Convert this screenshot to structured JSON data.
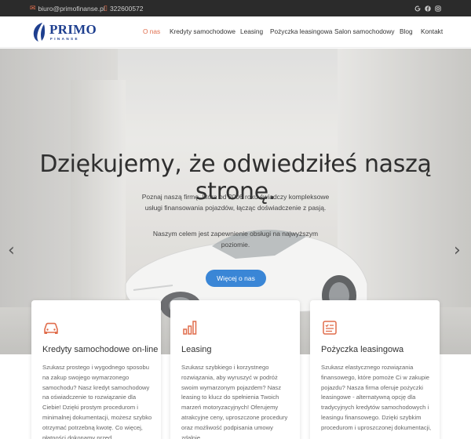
{
  "topbar": {
    "email": "biuro@primofinanse.pl",
    "phone": "322600572",
    "socials": [
      "google-icon",
      "facebook-icon",
      "instagram-icon"
    ]
  },
  "logo": {
    "name": "PRIMO",
    "sub": "FINANSE"
  },
  "nav": {
    "items": [
      {
        "label": "O nas",
        "active": true
      },
      {
        "label": "Kredyty samochodowe"
      },
      {
        "label": "Leasing"
      },
      {
        "label": "Pożyczka leasingowa"
      },
      {
        "label": "Salon samochodowy"
      },
      {
        "label": "Blog"
      },
      {
        "label": "Kontakt"
      }
    ]
  },
  "hero": {
    "title": "Dziękujemy, że odwiedziłeś naszą stronę.",
    "paragraph1": "Poznaj naszą firmę, która od 2006 roku świadczy kompleksowe usługi finansowania pojazdów, łącząc doświadczenie z pasją.",
    "paragraph2": "Naszym celem jest zapewnienie obsługi na najwyższym poziomie.",
    "button": "Więcej o nas",
    "prev": "‹",
    "next": "›"
  },
  "cards": [
    {
      "icon": "car-icon",
      "title": "Kredyty samochodowe on-line",
      "text": "Szukasz prostego i wygodnego sposobu na zakup swojego wymarzonego samochodu? Nasz kredyt samochodowy na oświadczenie to rozwiązanie dla Ciebie! Dzięki prostym procedurom i minimalnej dokumentacji, możesz szybko otrzymać potrzebną kwotę. Co więcej, płatności dokonamy przed"
    },
    {
      "icon": "bar-chart-icon",
      "title": "Leasing",
      "text": "Szukasz szybkiego i korzystnego rozwiązania, aby wyruszyć w podróż swoim wymarzonym pojazdem? Nasz leasing to klucz do spełnienia Twoich marzeń motoryzacyjnych! Oferujemy atrakcyjne ceny, uproszczone procedury oraz możliwość podpisania umowy zdalnie."
    },
    {
      "icon": "document-icon",
      "title": "Pożyczka leasingowa",
      "text": "Szukasz elastycznego rozwiązania finansowego, które pomoże Ci w zakupie pojazdu? Nasza firma oferuje pożyczki leasingowe - alternatywną opcję dla tradycyjnych kredytów samochodowych i leasingu finansowego. Dzięki szybkim procedurom i uproszczonej dokumentacji,"
    }
  ],
  "colors": {
    "accent": "#e06d4c",
    "button": "#3a86d6",
    "brand": "#1e3f8f",
    "topbar": "#2b2b2b"
  }
}
